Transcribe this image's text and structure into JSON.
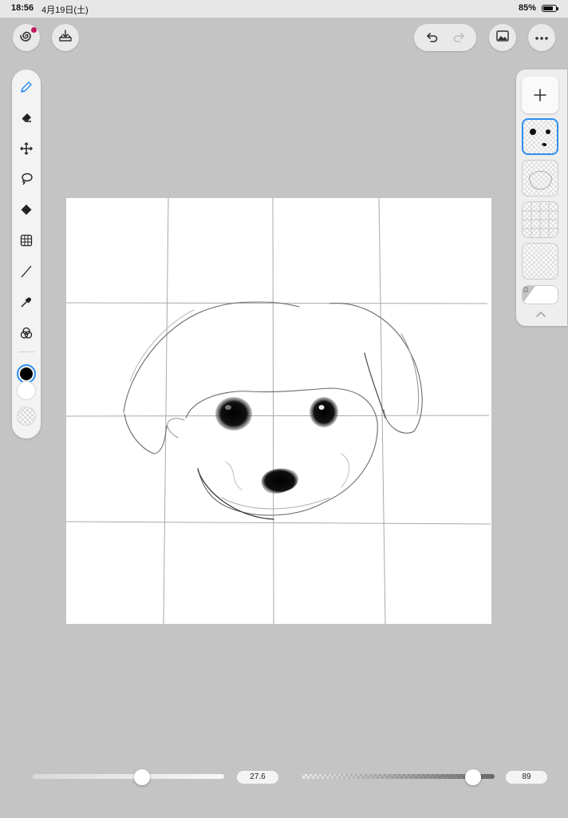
{
  "status_bar": {
    "time": "18:56",
    "date": "4月19日(土)",
    "battery": "85%"
  },
  "top_bar": {
    "left_buttons": [
      {
        "name": "gallery-button",
        "icon": "spiral-app-icon"
      },
      {
        "name": "import-button",
        "icon": "tray-download-icon"
      }
    ],
    "right_buttons": [
      {
        "name": "undo-button",
        "icon": "undo-arrow-icon"
      },
      {
        "name": "redo-button",
        "icon": "redo-arrow-icon",
        "disabled": true
      },
      {
        "name": "reference-image-button",
        "icon": "image-icon"
      },
      {
        "name": "more-button",
        "icon": "ellipsis-icon"
      }
    ]
  },
  "tools": [
    {
      "name": "pen",
      "icon": "pen-icon",
      "selected": true
    },
    {
      "name": "eraser",
      "icon": "eraser-icon"
    },
    {
      "name": "move",
      "icon": "move-arrows-icon"
    },
    {
      "name": "lasso",
      "icon": "lasso-icon"
    },
    {
      "name": "fill",
      "icon": "paint-bucket-icon"
    },
    {
      "name": "transform-grid",
      "icon": "grid-transform-icon"
    },
    {
      "name": "line",
      "icon": "line-icon"
    },
    {
      "name": "eyedropper",
      "icon": "eyedropper-icon"
    },
    {
      "name": "blend",
      "icon": "color-mix-icon"
    }
  ],
  "colors": {
    "primary": "#000000",
    "secondary": "#ffffff",
    "accent": "#2d8ef0"
  },
  "layers": [
    {
      "name": "eyes-nose-layer",
      "selected": true
    },
    {
      "name": "sketch-layer",
      "selected": false
    },
    {
      "name": "grid-layer",
      "selected": false
    },
    {
      "name": "empty-layer",
      "selected": false
    },
    {
      "name": "paper-layer",
      "selected": false
    }
  ],
  "sliders": {
    "brush_size": {
      "value_label": "27.6",
      "fraction": 0.57
    },
    "opacity": {
      "value_label": "89",
      "fraction": 0.89
    }
  }
}
